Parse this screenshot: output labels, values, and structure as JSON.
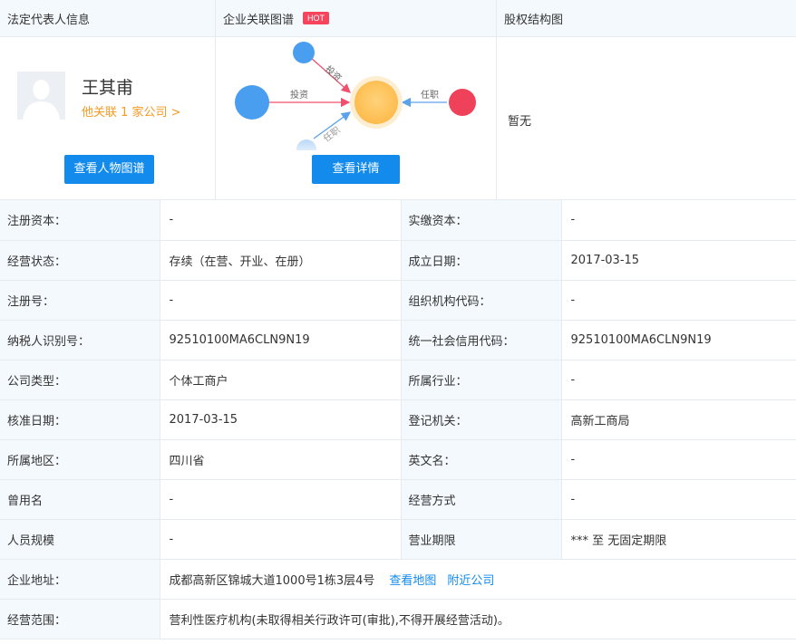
{
  "sections": {
    "legal_rep": {
      "title": "法定代表人信息",
      "name": "王其甫",
      "related_link": "他关联 1 家公司 >",
      "button": "查看人物图谱"
    },
    "relation_graph": {
      "title": "企业关联图谱",
      "badge": "HOT",
      "edge_invest_1": "投资",
      "edge_invest_2": "投资",
      "edge_role_1": "任职",
      "edge_role_2": "任职",
      "button": "查看详情"
    },
    "equity": {
      "title": "股权结构图",
      "empty_text": "暂无"
    }
  },
  "info_rows": [
    {
      "l1": "注册资本：",
      "v1": "-",
      "l2": "实缴资本：",
      "v2": "-"
    },
    {
      "l1": "经营状态：",
      "v1": "存续（在营、开业、在册）",
      "l2": "成立日期：",
      "v2": "2017-03-15"
    },
    {
      "l1": "注册号：",
      "v1": "-",
      "l2": "组织机构代码：",
      "v2": "-"
    },
    {
      "l1": "纳税人识别号：",
      "v1": "92510100MA6CLN9N19",
      "l2": "统一社会信用代码：",
      "v2": "92510100MA6CLN9N19"
    },
    {
      "l1": "公司类型：",
      "v1": "个体工商户",
      "l2": "所属行业：",
      "v2": "-"
    },
    {
      "l1": "核准日期：",
      "v1": "2017-03-15",
      "l2": "登记机关：",
      "v2": "高新工商局"
    },
    {
      "l1": "所属地区：",
      "v1": "四川省",
      "l2": "英文名：",
      "v2": "-"
    },
    {
      "l1": "曾用名",
      "v1": "-",
      "l2": "经营方式",
      "v2": "-"
    },
    {
      "l1": "人员规模",
      "v1": "-",
      "l2": "营业期限",
      "v2": "*** 至 无固定期限"
    }
  ],
  "address": {
    "label": "企业地址：",
    "value": "成都高新区锦城大道1000号1栋3层4号",
    "map_link": "查看地图",
    "nearby_link": "附近公司"
  },
  "scope": {
    "label": "经营范围：",
    "value": "营利性医疗机构(未取得相关行政许可(审批),不得开展经营活动)。"
  },
  "colors": {
    "accent": "#128bed",
    "hot": "#f5445c",
    "link_orange": "#f59a23",
    "header_bg": "#f4f9fd"
  }
}
